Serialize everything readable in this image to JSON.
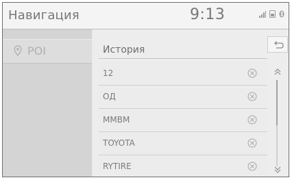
{
  "header": {
    "title": "Навигация",
    "time": "9:13",
    "status_icons": [
      "signal-bars-icon",
      "phone-icon",
      "bluetooth-icon"
    ]
  },
  "sidebar": {
    "items": [
      {
        "label": "POI",
        "icon": "map-pin-icon"
      }
    ]
  },
  "main": {
    "title": "История",
    "items": [
      {
        "label": "12"
      },
      {
        "label": "ОД"
      },
      {
        "label": "MMBM"
      },
      {
        "label": "TOYOTA"
      },
      {
        "label": "RYTIRE"
      }
    ],
    "scroll": {
      "position": 0.0,
      "visible_fraction": 0.52
    }
  },
  "colors": {
    "background": "#e9e9e9",
    "header": "#f4f4f4",
    "sidebar": "#d4d4d4",
    "text": "#6a6a6a"
  }
}
